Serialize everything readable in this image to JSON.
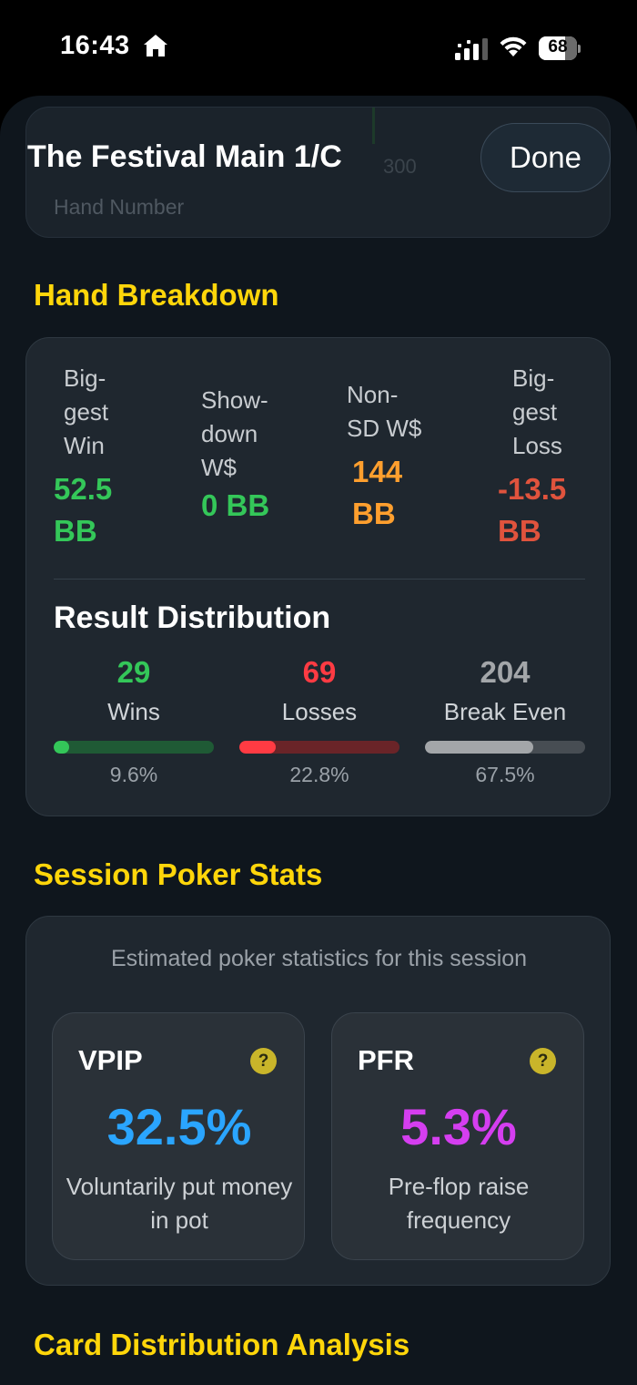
{
  "status_bar": {
    "time": "16:43",
    "battery_level": 68,
    "battery_label": "68",
    "icons": [
      "home-icon",
      "cellular-signal-icon",
      "wifi-icon",
      "battery-icon"
    ]
  },
  "sheet": {
    "title": "The Festival Main 1/C",
    "done_label": "Done",
    "background_chart": {
      "tick_label": "300",
      "axis_label": "Hand Number"
    }
  },
  "hand_breakdown": {
    "heading": "Hand Breakdown",
    "stats": [
      {
        "label": "Big-\ngest\nWin",
        "value": "52.5\nBB",
        "color": "#34c759"
      },
      {
        "label": "Show-\ndown\nW$",
        "value": "0 BB",
        "color": "#34c759"
      },
      {
        "label": "Non-\nSD W$",
        "value": "144\nBB",
        "color": "#ff9f2e"
      },
      {
        "label": "Big-\ngest\nLoss",
        "value": "-13.5\nBB",
        "color": "#e0533d"
      }
    ],
    "result_distribution": {
      "heading": "Result Distribution",
      "items": [
        {
          "count": "29",
          "label": "Wins",
          "percent_label": "9.6%",
          "fraction": 0.096,
          "color": "#34c759",
          "track_color": "#1f5a35"
        },
        {
          "count": "69",
          "label": "Losses",
          "percent_label": "22.8%",
          "fraction": 0.228,
          "color": "#ff3b43",
          "track_color": "#6a2428"
        },
        {
          "count": "204",
          "label": "Break Even",
          "percent_label": "67.5%",
          "fraction": 0.675,
          "color": "#a3a6a9",
          "track_color": "#474d53"
        }
      ]
    }
  },
  "session_stats": {
    "heading": "Session Poker Stats",
    "caption": "Estimated poker statistics for this session",
    "tiles": [
      {
        "title": "VPIP",
        "value": "32.5%",
        "description": "Voluntarily put money in pot",
        "color": "#2aa5ff",
        "help": "?"
      },
      {
        "title": "PFR",
        "value": "5.3%",
        "description": "Pre-flop raise frequency",
        "color": "#d53ef0",
        "help": "?"
      }
    ]
  },
  "card_distribution": {
    "heading": "Card Distribution Analysis"
  }
}
